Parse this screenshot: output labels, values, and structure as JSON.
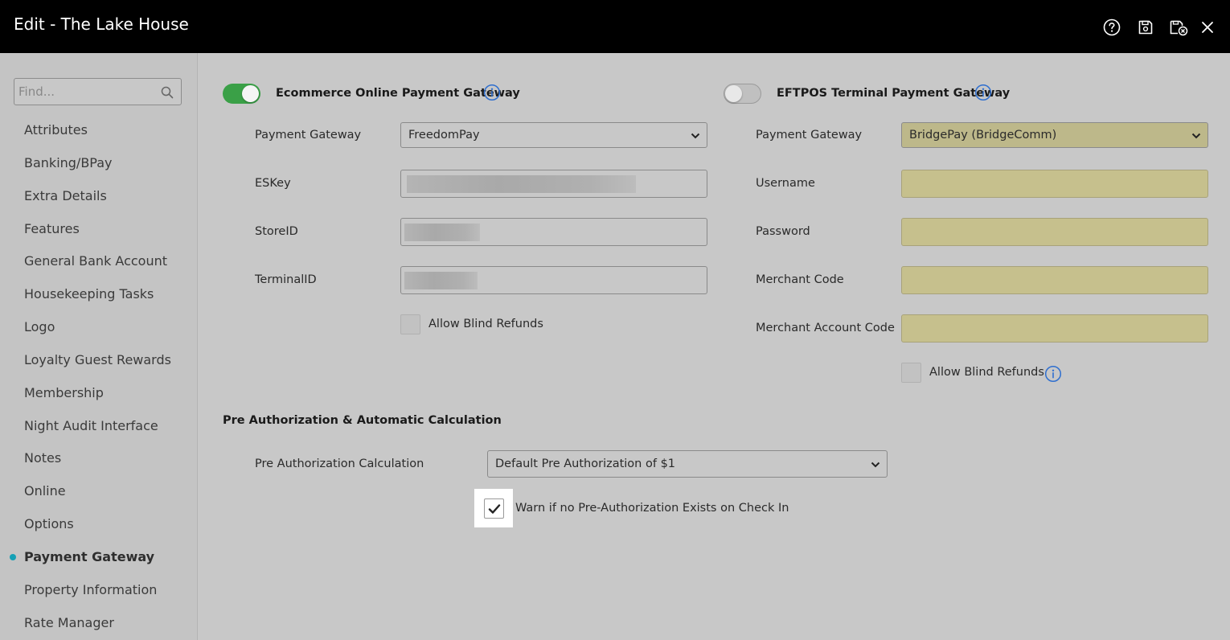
{
  "window": {
    "title": "Edit - The Lake House",
    "icons": [
      "help-icon",
      "save-icon",
      "save-close-icon",
      "close-icon"
    ]
  },
  "sidebar": {
    "search_placeholder": "Find...",
    "items": [
      {
        "label": "Attributes"
      },
      {
        "label": "Banking/BPay"
      },
      {
        "label": "Extra Details"
      },
      {
        "label": "Features"
      },
      {
        "label": "General Bank Account"
      },
      {
        "label": "Housekeeping Tasks"
      },
      {
        "label": "Logo"
      },
      {
        "label": "Loyalty Guest Rewards"
      },
      {
        "label": "Membership"
      },
      {
        "label": "Night Audit Interface"
      },
      {
        "label": "Notes"
      },
      {
        "label": "Online"
      },
      {
        "label": "Options"
      },
      {
        "label": "Payment Gateway",
        "active": true
      },
      {
        "label": "Property Information"
      },
      {
        "label": "Rate Manager"
      }
    ],
    "active_color": "#15a0b5"
  },
  "ecommerce": {
    "title": "Ecommerce Online Payment Gateway",
    "enabled": true,
    "toggle_color": "#3aa047",
    "gateway_label": "Payment Gateway",
    "gateway_value": "FreedomPay",
    "eskey_label": "ESKey",
    "storeid_label": "StoreID",
    "terminalid_label": "TerminalID",
    "blind_refunds_label": "Allow Blind Refunds",
    "blind_refunds_checked": false
  },
  "eftpos": {
    "title": "EFTPOS Terminal Payment Gateway",
    "enabled": false,
    "gateway_label": "Payment Gateway",
    "gateway_value": "BridgePay (BridgeComm)",
    "username_label": "Username",
    "password_label": "Password",
    "merchant_code_label": "Merchant Code",
    "merchant_account_code_label": "Merchant Account Code",
    "blind_refunds_label": "Allow Blind Refunds",
    "blind_refunds_checked": false,
    "field_color": "#c6c08d"
  },
  "preauth": {
    "title": "Pre Authorization & Automatic Calculation",
    "calc_label": "Pre Authorization Calculation",
    "calc_value": "Default Pre Authorization of $1",
    "warn_label": "Warn if no Pre-Authorization Exists on Check In",
    "warn_checked": true
  }
}
